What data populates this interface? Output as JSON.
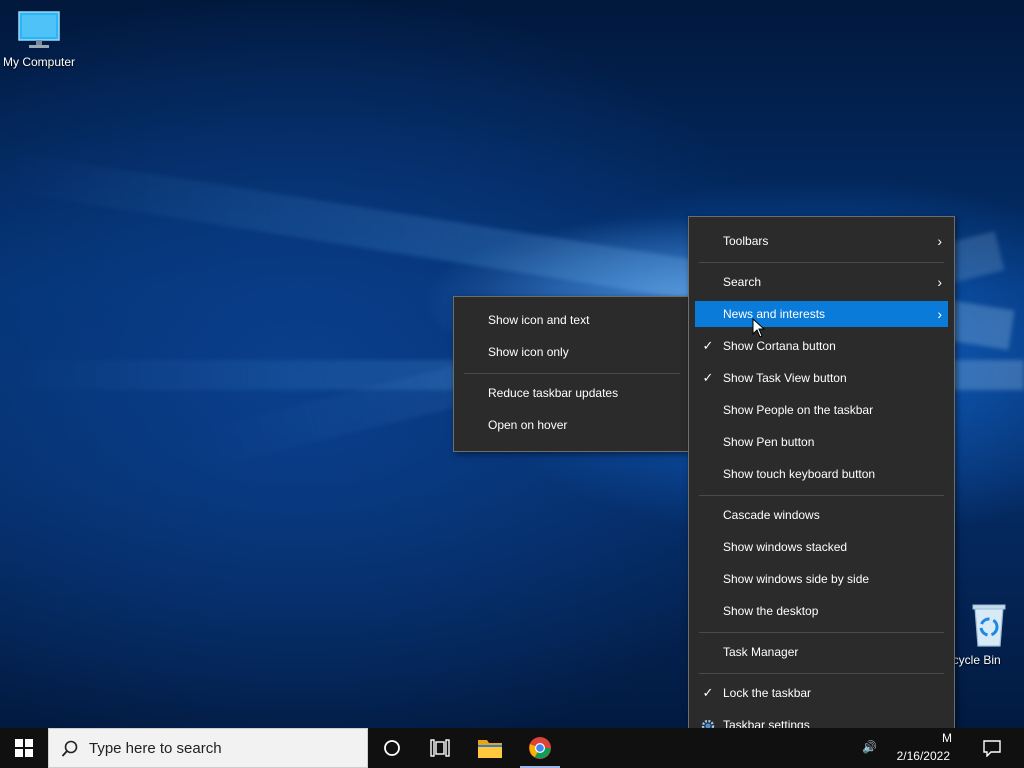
{
  "desktop": {
    "icons": [
      {
        "label": "My Computer"
      },
      {
        "label": "ecycle Bin"
      }
    ]
  },
  "context_menu": {
    "items": [
      {
        "label": "Toolbars",
        "submenu": true
      },
      {
        "label": "Search",
        "submenu": true
      },
      {
        "label": "News and interests",
        "submenu": true,
        "selected": true
      },
      {
        "label": "Show Cortana button",
        "checked": true
      },
      {
        "label": "Show Task View button",
        "checked": true
      },
      {
        "label": "Show People on the taskbar"
      },
      {
        "label": "Show Pen button"
      },
      {
        "label": "Show touch keyboard button"
      },
      {
        "label": "Cascade windows"
      },
      {
        "label": "Show windows stacked"
      },
      {
        "label": "Show windows side by side"
      },
      {
        "label": "Show the desktop"
      },
      {
        "label": "Task Manager"
      },
      {
        "label": "Lock the taskbar",
        "checked": true
      },
      {
        "label": "Taskbar settings",
        "icon": "gear-icon"
      }
    ]
  },
  "submenu": {
    "items": [
      {
        "label": "Show icon and text"
      },
      {
        "label": "Show icon only"
      },
      {
        "label": "Reduce taskbar updates"
      },
      {
        "label": "Open on hover"
      }
    ]
  },
  "taskbar": {
    "search_placeholder": "Type here to search",
    "clock_time": "M",
    "clock_date": "2/16/2022"
  },
  "colors": {
    "menu_bg": "#2b2b2b",
    "menu_highlight": "#0a7bd8",
    "taskbar_bg": "#101010"
  }
}
